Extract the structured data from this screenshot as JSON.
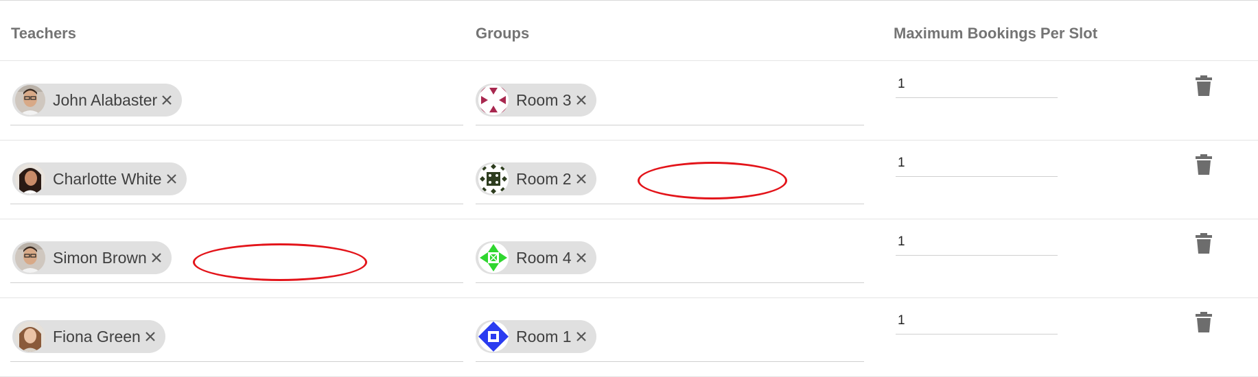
{
  "columns": {
    "teachers": "Teachers",
    "groups": "Groups",
    "max_bookings": "Maximum Bookings Per Slot"
  },
  "rows": [
    {
      "teacher": "John Alabaster",
      "group": "Room 3",
      "group_color": "#a8284f",
      "max_bookings": "1"
    },
    {
      "teacher": "Charlotte White",
      "group": "Room 2",
      "group_color": "#2e3d1f",
      "max_bookings": "1"
    },
    {
      "teacher": "Simon Brown",
      "group": "Room 4",
      "group_color": "#2fd62f",
      "max_bookings": "1"
    },
    {
      "teacher": "Fiona Green",
      "group": "Room 1",
      "group_color": "#2a3cf0",
      "max_bookings": "1"
    }
  ],
  "icons": {
    "remove": "close-icon",
    "delete": "trash-icon"
  },
  "colors": {
    "chip_background": "#e0e0e0",
    "header_text": "#747474",
    "delete_icon": "#6d6d6d",
    "annotation": "#e3141a"
  }
}
